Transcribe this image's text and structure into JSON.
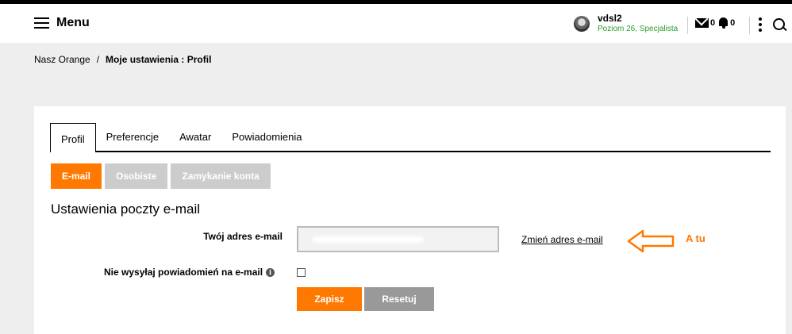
{
  "header": {
    "menu_label": "Menu",
    "user_name": "vdsl2",
    "user_level": "Poziom 26, Specjalista",
    "messages_count": "0",
    "notifications_count": "0"
  },
  "breadcrumb": {
    "root": "Nasz Orange",
    "separator": "/",
    "current": "Moje ustawienia : Profil"
  },
  "tabs": [
    "Profil",
    "Preferencje",
    "Awatar",
    "Powiadomienia"
  ],
  "subtabs": [
    "E-mail",
    "Osobiste",
    "Zamykanie konta"
  ],
  "form": {
    "section_title": "Ustawienia poczty e-mail",
    "email_label": "Twój adres e-mail",
    "email_value": "",
    "change_email_link": "Zmień adres e-mail",
    "no_email_label": "Nie wysyłaj powiadomień na e-mail",
    "save_button": "Zapisz",
    "reset_button": "Resetuj"
  },
  "annotation": {
    "text": "A tu"
  },
  "colors": {
    "accent": "#ff7900",
    "status_green": "#2a9d2a",
    "disabled_grey": "#cccccc"
  }
}
